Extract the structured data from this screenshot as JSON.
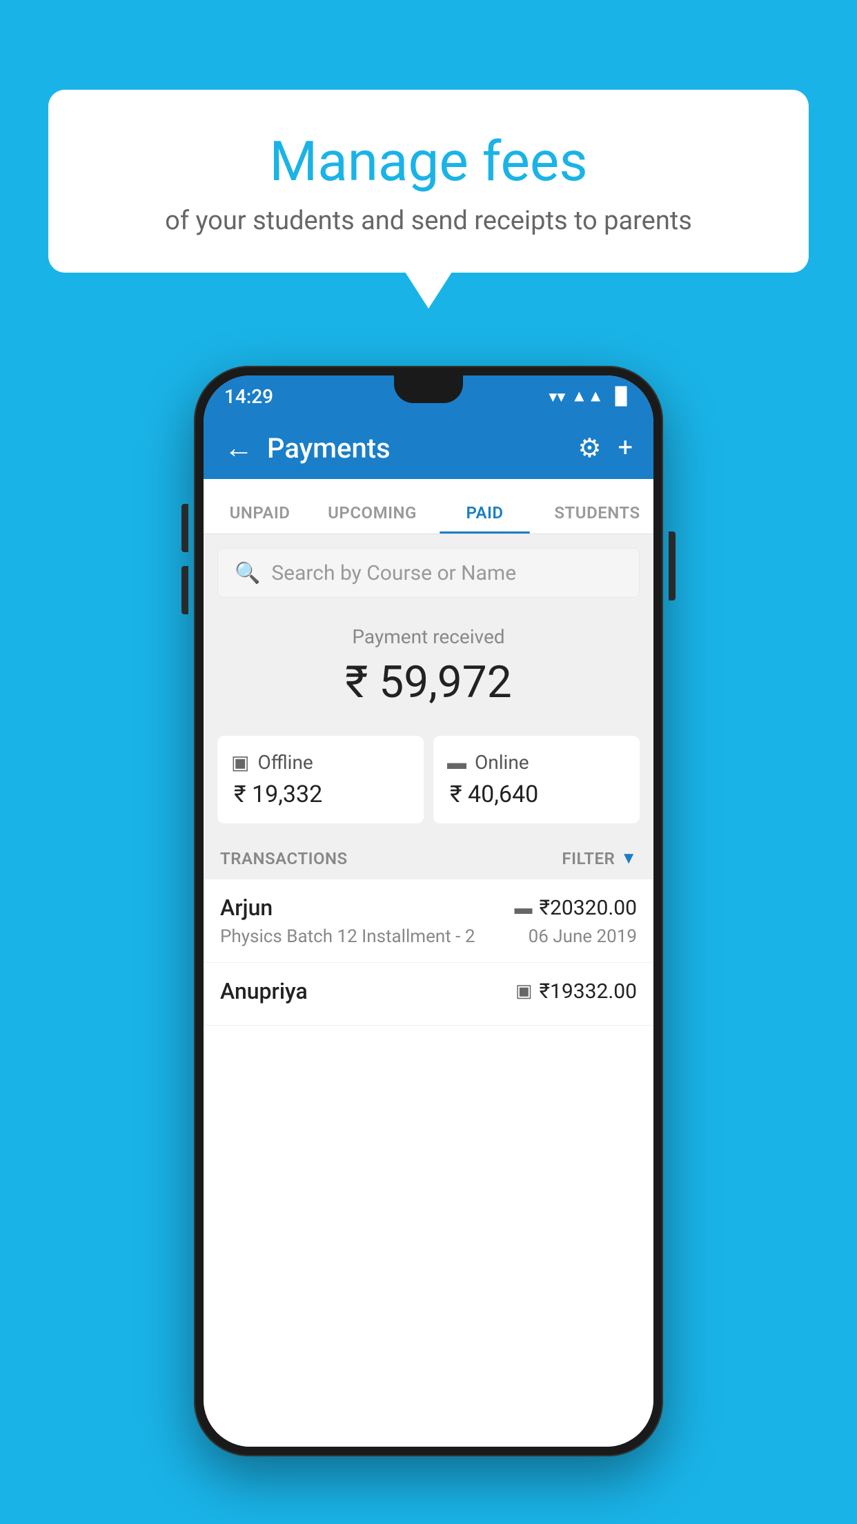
{
  "background_color": "#1ab3e8",
  "speech_bubble": {
    "title": "Manage fees",
    "subtitle": "of your students and send receipts to parents"
  },
  "status_bar": {
    "time": "14:29",
    "wifi": "▼",
    "signal": "◀",
    "battery": "▐"
  },
  "app_bar": {
    "title": "Payments",
    "back_label": "←",
    "gear_label": "⚙",
    "plus_label": "+"
  },
  "tabs": [
    {
      "id": "unpaid",
      "label": "UNPAID",
      "active": false
    },
    {
      "id": "upcoming",
      "label": "UPCOMING",
      "active": false
    },
    {
      "id": "paid",
      "label": "PAID",
      "active": true
    },
    {
      "id": "students",
      "label": "STUDENTS",
      "active": false
    }
  ],
  "search": {
    "placeholder": "Search by Course or Name"
  },
  "payment_summary": {
    "label": "Payment received",
    "amount": "₹ 59,972",
    "offline": {
      "type": "Offline",
      "amount": "₹ 19,332"
    },
    "online": {
      "type": "Online",
      "amount": "₹ 40,640"
    }
  },
  "transactions_section": {
    "label": "TRANSACTIONS",
    "filter_label": "FILTER",
    "items": [
      {
        "name": "Arjun",
        "amount": "₹20320.00",
        "course": "Physics Batch 12 Installment - 2",
        "date": "06 June 2019",
        "payment_type": "online"
      },
      {
        "name": "Anupriya",
        "amount": "₹19332.00",
        "course": "",
        "date": "",
        "payment_type": "offline"
      }
    ]
  }
}
